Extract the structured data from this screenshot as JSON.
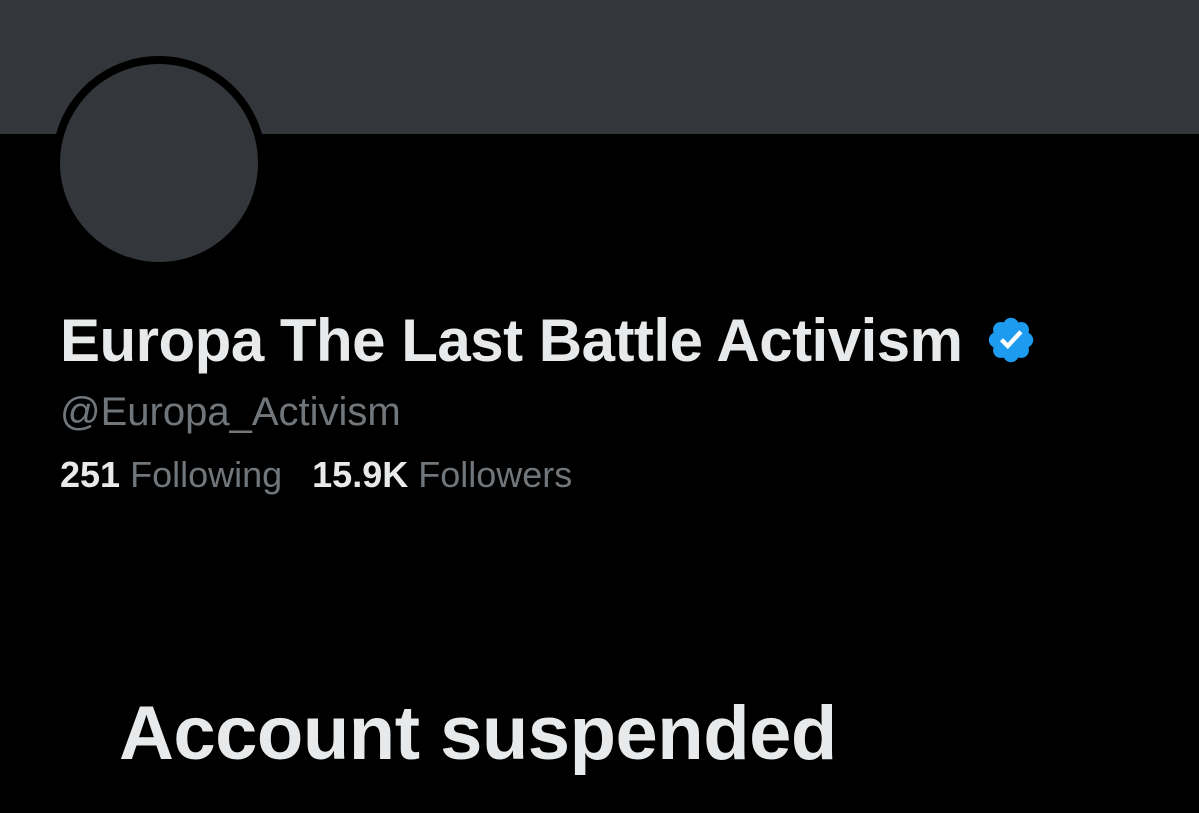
{
  "profile": {
    "display_name": "Europa The Last Battle Activism",
    "handle": "@Europa_Activism",
    "verified_icon": "verified-badge-icon",
    "avatar": "default-avatar",
    "stats": {
      "following_value": "251",
      "following_label": "Following",
      "followers_value": "15.9K",
      "followers_label": "Followers"
    }
  },
  "status": {
    "message": "Account suspended"
  },
  "colors": {
    "background": "#000000",
    "banner": "#33363b",
    "primary_text": "#e7e9ea",
    "secondary_text": "#71767b",
    "verified_blue": "#1d9bf0"
  }
}
